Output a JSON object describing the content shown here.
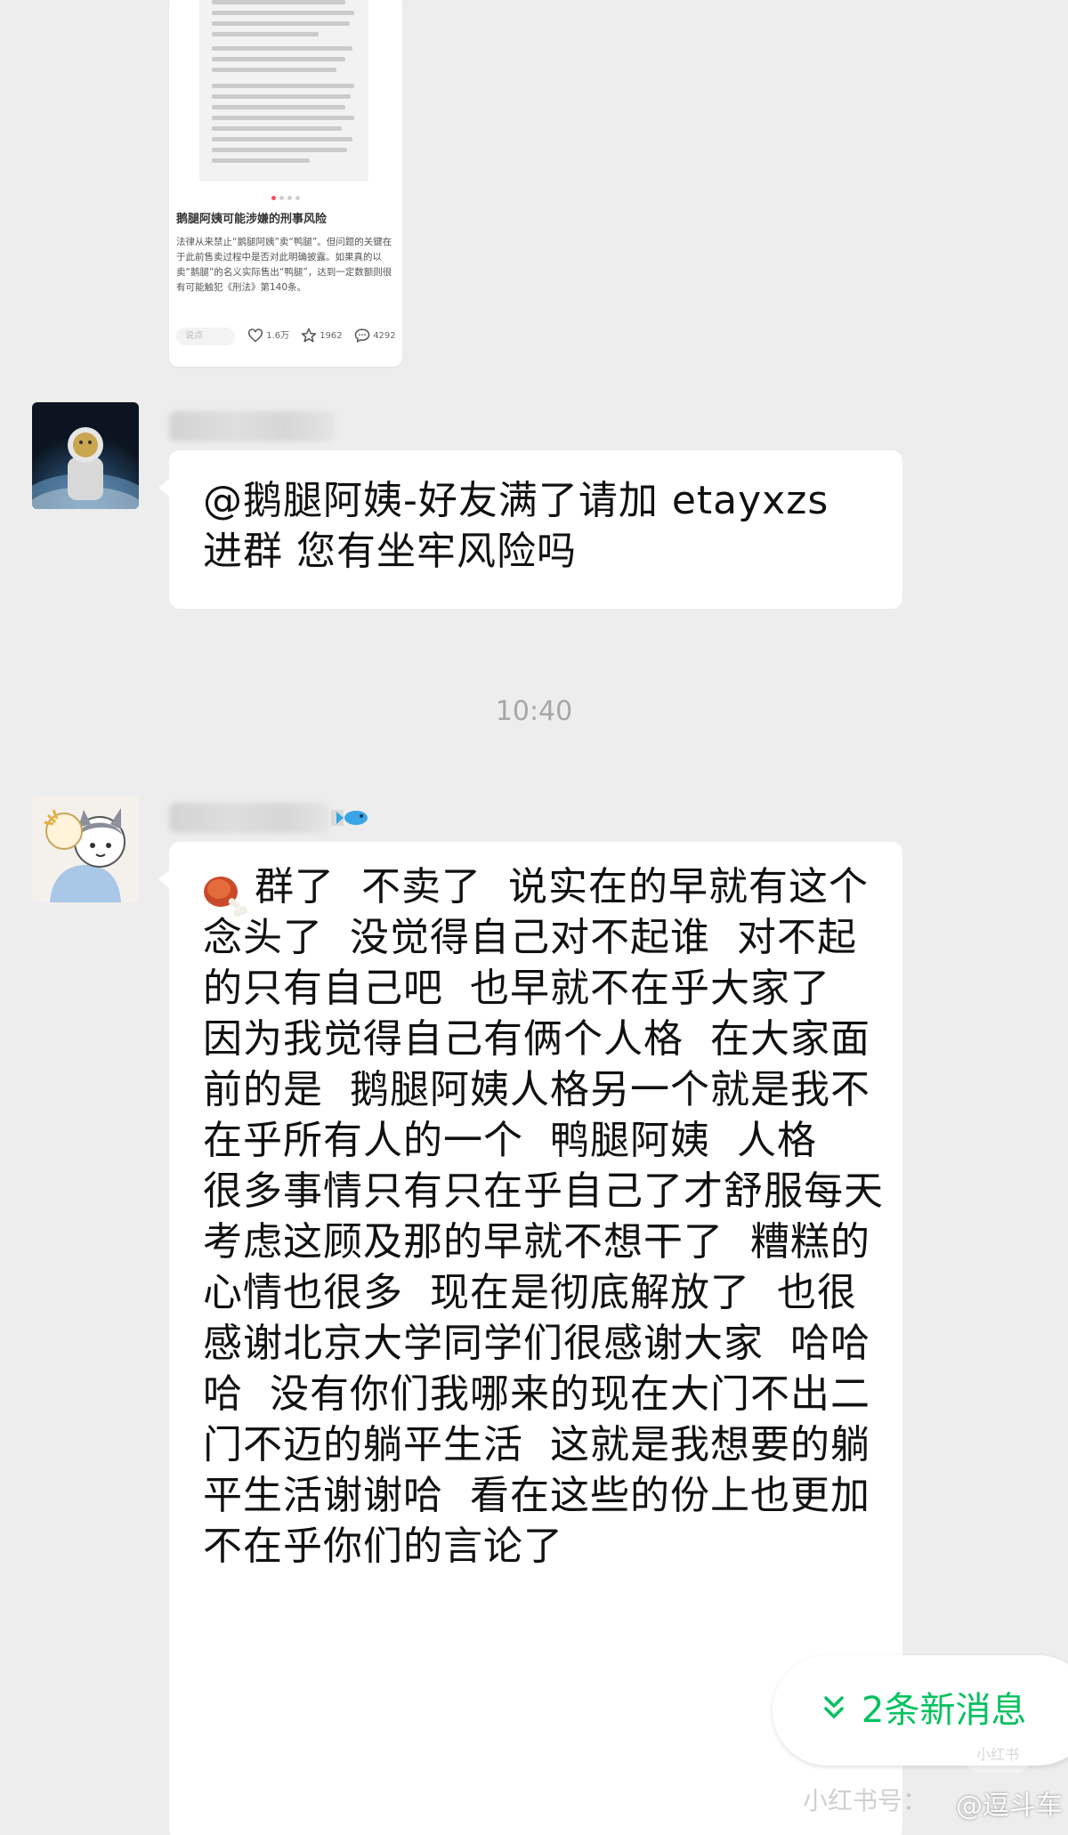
{
  "shared_card": {
    "title": "鹅腿阿姨可能涉嫌的刑事风险",
    "body": "法律从来禁止“鹅腿阿姨”卖“鸭腿”。但问题的关键在于此前售卖过程中是否对此明确披露。如果真的以卖“鹅腿”的名义实际售出“鸭腿”，达到一定数额则很有可能触犯《刑法》第140条。",
    "comment_placeholder": "说点",
    "likes": "1.6万",
    "stars": "1962",
    "comments": "4292"
  },
  "messages": [
    {
      "text": "@鹅腿阿姨-好友满了请加 etayxzs 进群  您有坐牢风险吗"
    },
    {
      "text": "群了  不卖了  说实在的早就有这个念头了  没觉得自己对不起谁  对不起的只有自己吧  也早就不在乎大家了  因为我觉得自己有俩个人格  在大家面前的是  鹅腿阿姨人格另一个就是我不在乎所有人的一个  鸭腿阿姨  人格\n很多事情只有只在乎自己了才舒服每天考虑这顾及那的早就不想干了  糟糕的心情也很多  现在是彻底解放了  也很感谢北京大学同学们很感谢大家  哈哈哈  没有你们我哪来的现在大门不出二门不迈的躺平生活  这就是我想要的躺平生活谢谢哈  看在这些的份上也更加不在乎你们的言论了"
    }
  ],
  "timestamp": "10:40",
  "new_messages": "2条新消息",
  "watermarks": {
    "xhs": "小红书号：",
    "weibo": "@逗斗车",
    "logo": "小红书"
  },
  "colors": {
    "background": "#ededed",
    "bubble": "#ffffff",
    "accent_green": "#07c160",
    "timestamp": "#a7a7a7"
  },
  "icons": [
    "meat-emoji-icon",
    "fish-emoji-icon",
    "heart-icon",
    "star-icon",
    "comment-icon",
    "chevron-double-down-icon"
  ]
}
